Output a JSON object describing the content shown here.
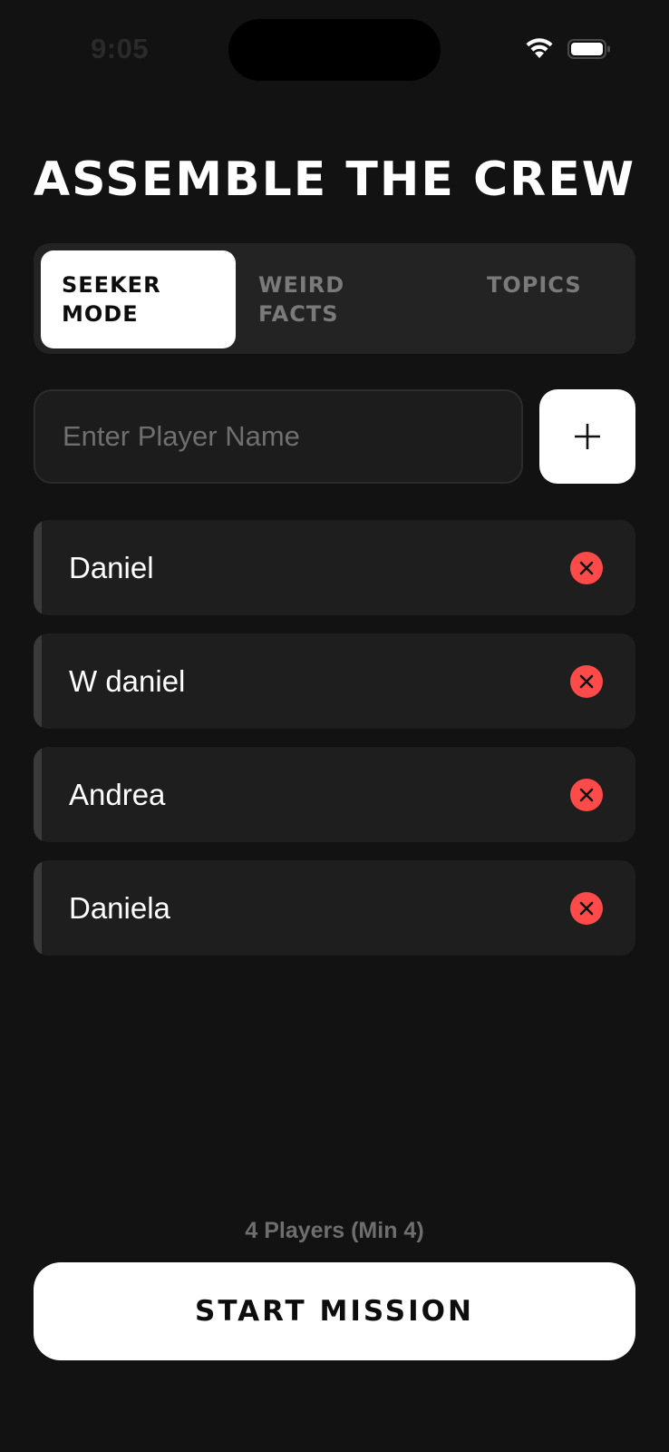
{
  "status_bar": {
    "time": "9:05",
    "icons": [
      "wifi-icon",
      "battery-icon"
    ]
  },
  "title": "ASSEMBLE THE CREW",
  "tabs": [
    {
      "label": "SEEKER\nMODE",
      "active": true
    },
    {
      "label": "WEIRD\nFACTS",
      "active": false
    },
    {
      "label": "TOPICS",
      "active": false
    }
  ],
  "input": {
    "placeholder": "Enter Player Name",
    "value": ""
  },
  "add_button_icon": "plus-icon",
  "players": [
    {
      "name": "Daniel"
    },
    {
      "name": "W daniel"
    },
    {
      "name": "Andrea"
    },
    {
      "name": "Daniela"
    }
  ],
  "remove_icon": "close-icon",
  "footer": {
    "player_count": "4 Players (Min 4)",
    "start_label": "START MISSION"
  },
  "colors": {
    "background": "#121212",
    "surface": "#1e1e1e",
    "accent": "#ffffff",
    "danger": "#ff4a4a"
  }
}
